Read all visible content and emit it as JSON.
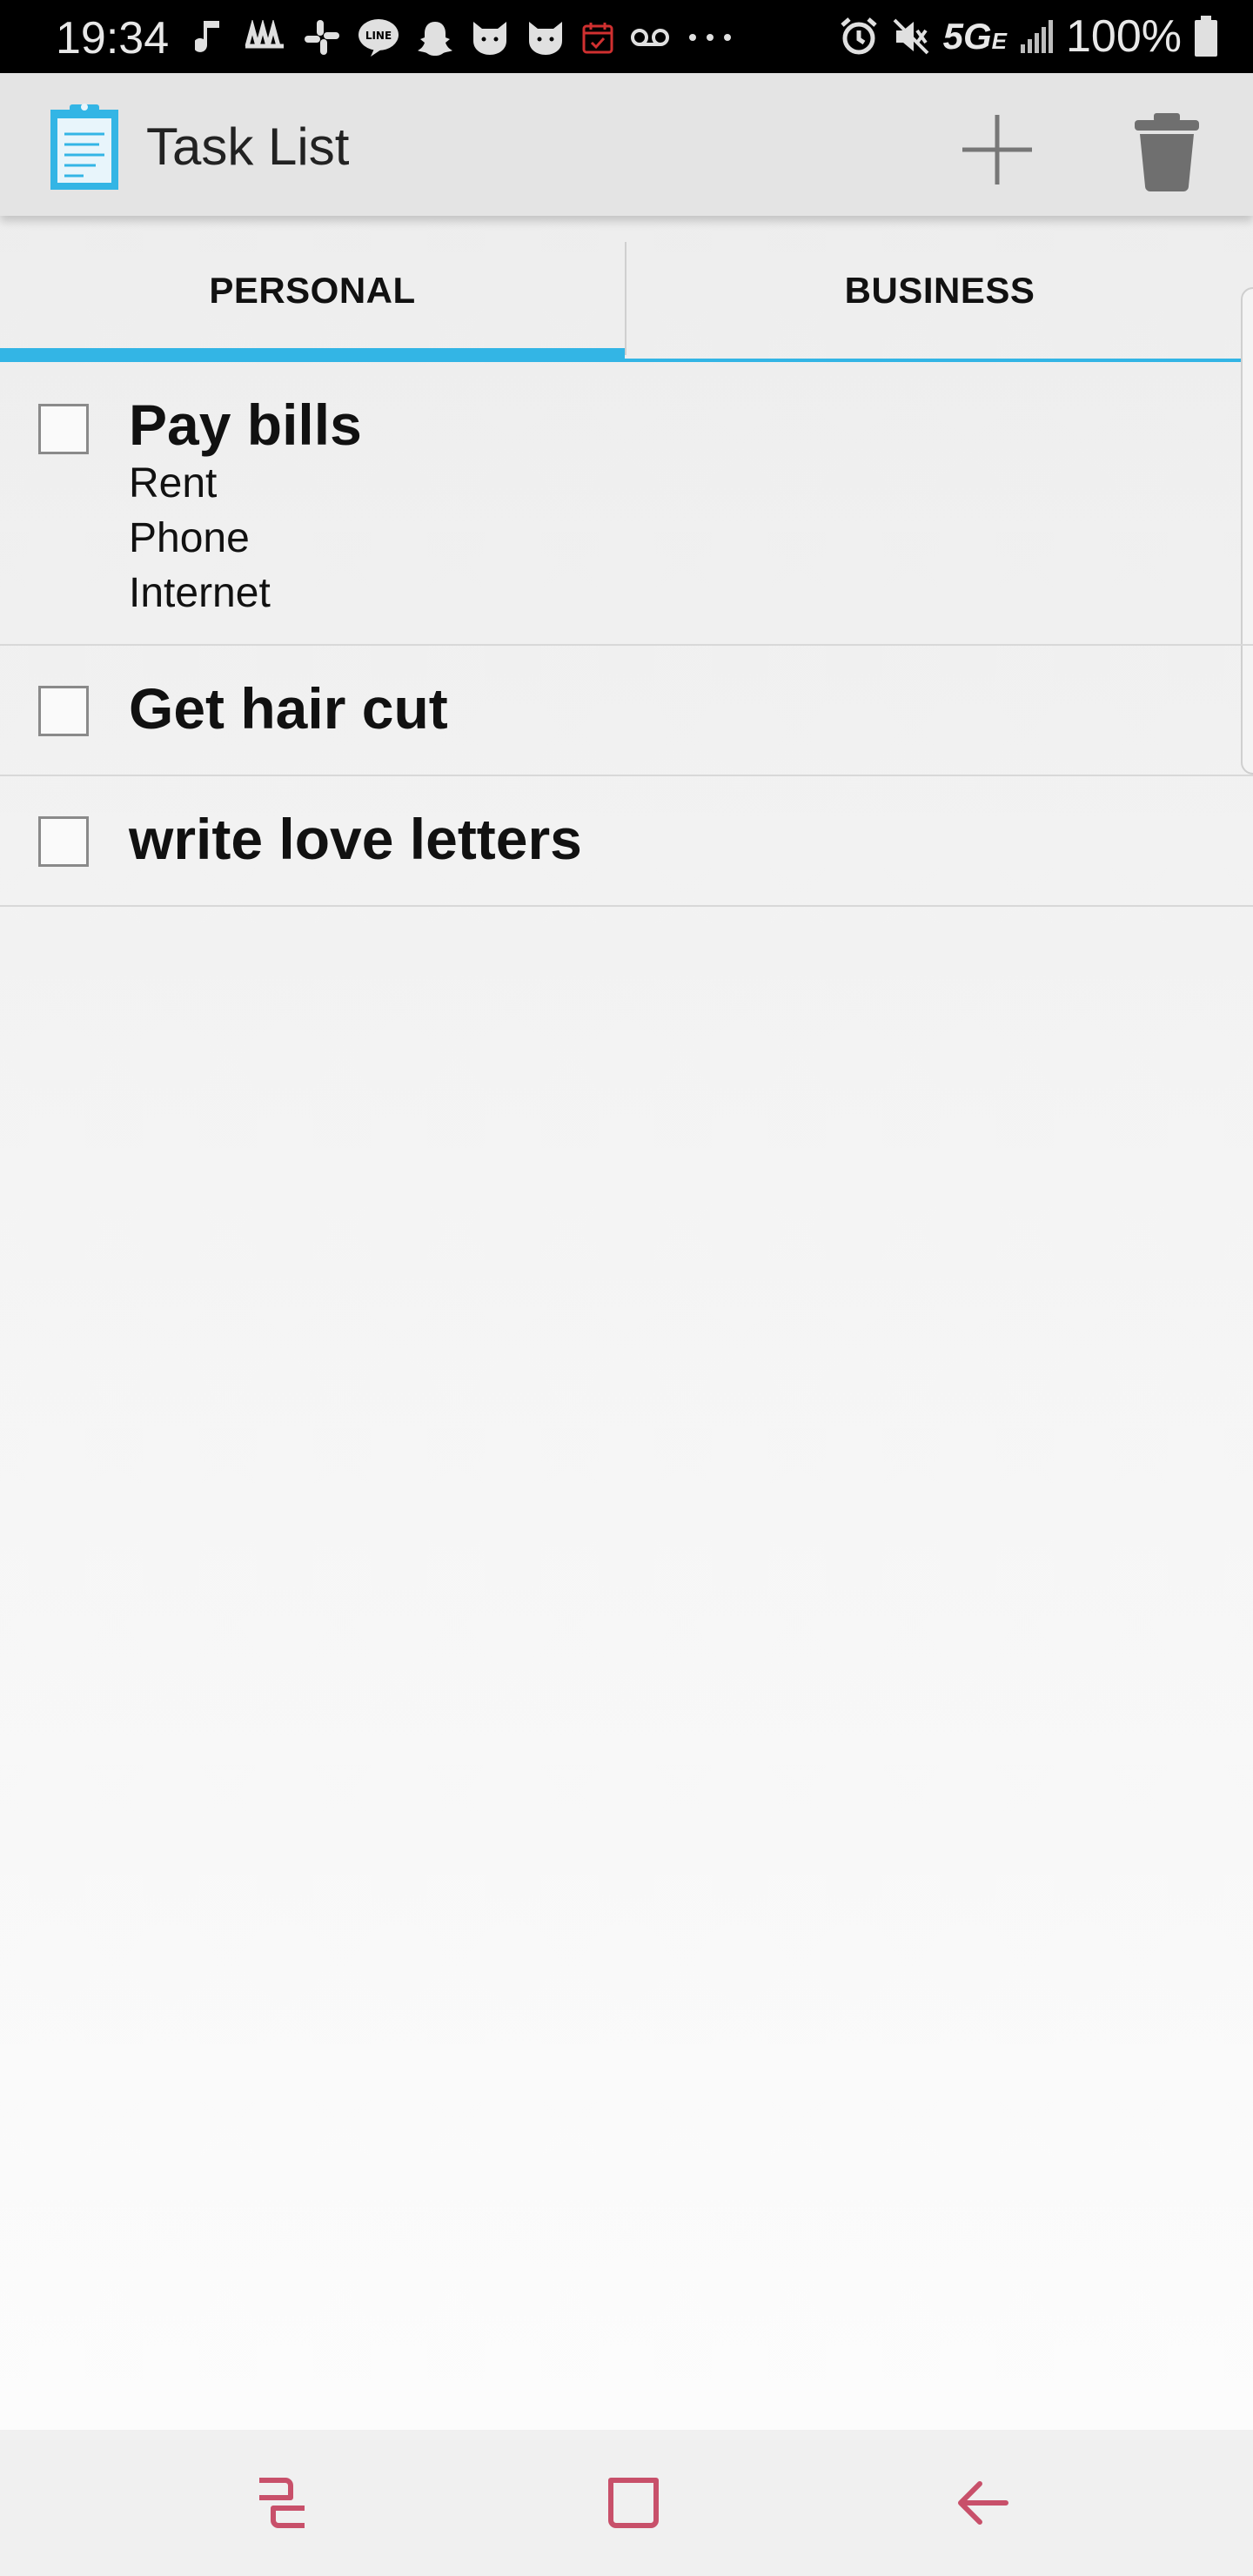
{
  "status_bar": {
    "time": "19:34",
    "network": "5G",
    "network_sub": "E",
    "battery": "100%",
    "left_icons": [
      "music-note-icon",
      "app-icon",
      "slack-icon",
      "line-icon",
      "snapchat-icon",
      "cat-icon",
      "cat-icon",
      "calendar-icon",
      "voicemail-icon",
      "more-dots-icon"
    ]
  },
  "app_bar": {
    "title": "Task List",
    "icon": "clipboard-icon",
    "accent_color": "#33b5e5"
  },
  "tabs": [
    {
      "label": "PERSONAL",
      "selected": true
    },
    {
      "label": "BUSINESS",
      "selected": false
    }
  ],
  "tasks": [
    {
      "title": "Pay bills",
      "checked": false,
      "notes": [
        "Rent",
        "Phone",
        "Internet"
      ]
    },
    {
      "title": "Get hair cut",
      "checked": false,
      "notes": []
    },
    {
      "title": "write love letters",
      "checked": false,
      "notes": []
    }
  ],
  "nav_bar": {
    "buttons": [
      "recent-apps-icon",
      "home-icon",
      "back-icon"
    ],
    "color": "#c8506a"
  }
}
